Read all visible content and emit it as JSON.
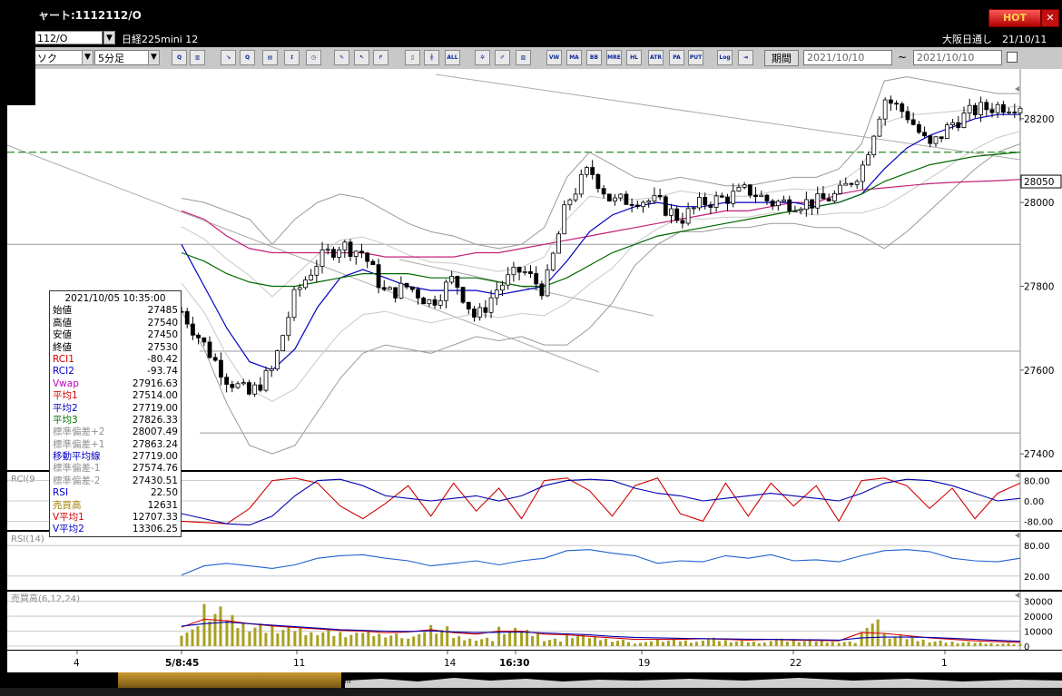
{
  "window": {
    "title": "ャート:1112112/O",
    "hot_label": "HOT",
    "close_label": "✕"
  },
  "toolbar1": {
    "symbol_code": "112/O",
    "symbol_name": "日経225mini 12",
    "exchange_date": "大阪日通し　21/10/11"
  },
  "toolbar2": {
    "chart_type": "ソク",
    "interval": "5分足",
    "period_label": "期間",
    "date_from": "2021/10/10",
    "date_to": "2021/10/10",
    "tilde": "~",
    "buttons": [
      {
        "icon": "zoom-icon",
        "label": "Q"
      },
      {
        "icon": "grid-icon",
        "label": "▥"
      },
      {
        "icon": "trend-icon",
        "label": "↘"
      },
      {
        "icon": "search-icon",
        "label": "Q"
      },
      {
        "icon": "chart-icon",
        "label": "▤"
      },
      {
        "icon": "ticker-icon",
        "label": "↕"
      },
      {
        "icon": "clock-icon",
        "label": "◷"
      },
      {
        "icon": "pen-icon",
        "label": "✎"
      },
      {
        "icon": "pointer-icon",
        "label": "↖"
      },
      {
        "icon": "arrow-icon",
        "label": "↱"
      },
      {
        "icon": "candle-icon",
        "label": "▯"
      },
      {
        "icon": "bar-icon",
        "label": "╫"
      },
      {
        "icon": "all-icon",
        "label": "ALL"
      },
      {
        "icon": "settings-icon",
        "label": "✲"
      },
      {
        "icon": "tool-icon",
        "label": "✐"
      },
      {
        "icon": "color-icon",
        "label": "▨"
      },
      {
        "icon": "vwap-icon",
        "label": "VW"
      },
      {
        "icon": "ma-icon",
        "label": "MA"
      },
      {
        "icon": "bb-icon",
        "label": "BB"
      },
      {
        "icon": "mre-icon",
        "label": "MRE"
      },
      {
        "icon": "hl-icon",
        "label": "HL"
      },
      {
        "icon": "atr-icon",
        "label": "ATR"
      },
      {
        "icon": "para-icon",
        "label": "PA"
      },
      {
        "icon": "put-icon",
        "label": "PUT"
      },
      {
        "icon": "log-icon",
        "label": "Log"
      },
      {
        "icon": "export-icon",
        "label": "⇥"
      }
    ]
  },
  "info": {
    "datetime": "2021/10/05  10:35:00",
    "rows": [
      {
        "k": "始値",
        "v": "27485",
        "c": "#000000"
      },
      {
        "k": "高値",
        "v": "27540",
        "c": "#000000"
      },
      {
        "k": "安値",
        "v": "27450",
        "c": "#000000"
      },
      {
        "k": "終値",
        "v": "27530",
        "c": "#000000"
      },
      {
        "k": "RCI1",
        "v": "-80.42",
        "c": "#d40000"
      },
      {
        "k": "RCI2",
        "v": "-93.74",
        "c": "#0000c8"
      },
      {
        "k": "Vwap",
        "v": "27916.63",
        "c": "#c000c0"
      },
      {
        "k": "平均1",
        "v": "27514.00",
        "c": "#d40000"
      },
      {
        "k": "平均2",
        "v": "27719.00",
        "c": "#0000c8"
      },
      {
        "k": "平均3",
        "v": "27826.33",
        "c": "#007000"
      },
      {
        "k": "標準偏差+2",
        "v": "28007.49",
        "c": "#909090"
      },
      {
        "k": "標準偏差+1",
        "v": "27863.24",
        "c": "#909090"
      },
      {
        "k": "移動平均線",
        "v": "27719.00",
        "c": "#0000c8"
      },
      {
        "k": "標準偏差-1",
        "v": "27574.76",
        "c": "#909090"
      },
      {
        "k": "標準偏差-2",
        "v": "27430.51",
        "c": "#909090"
      },
      {
        "k": "RSI",
        "v": "22.50",
        "c": "#0000c8"
      },
      {
        "k": "売買高",
        "v": "12631",
        "c": "#a08000"
      },
      {
        "k": "V平均1",
        "v": "12707.33",
        "c": "#d40000"
      },
      {
        "k": "V平均2",
        "v": "13306.25",
        "c": "#0000c8"
      }
    ]
  },
  "chart_data": [
    {
      "type": "line",
      "subtype": "candlestick",
      "y_ticks": [
        "28200",
        "28000",
        "27800",
        "27600",
        "27400"
      ],
      "ylim": [
        27370,
        28310
      ],
      "current_price": "28050",
      "x_ticks": [
        "4",
        "5/8:45",
        "11",
        "14",
        "16:30",
        "19",
        "22",
        "1"
      ],
      "price_path": [
        27740,
        27660,
        27580,
        27540,
        27600,
        27780,
        27860,
        27900,
        27880,
        27780,
        27800,
        27760,
        27820,
        27720,
        27800,
        27840,
        27790,
        28000,
        28080,
        28000,
        28010,
        28000,
        27960,
        28000,
        28010,
        28030,
        28000,
        28000,
        28000,
        28020,
        28080,
        28250,
        28210,
        28130,
        28190,
        28220,
        28230,
        28235
      ],
      "reference_lines": [
        28120,
        27900,
        27645,
        27450
      ],
      "series": [
        {
          "name": "Vwap",
          "color": "#c0207a",
          "values": [
            27980,
            27960,
            27920,
            27890,
            27880,
            27880,
            27880,
            27880,
            27880,
            27870,
            27870,
            27870,
            27870,
            27880,
            27880,
            27890,
            27900,
            27910,
            27920,
            27930,
            27940,
            27950,
            27960,
            27970,
            27980,
            27980,
            27990,
            28000,
            28000,
            28020,
            28030,
            28035,
            28040,
            28045,
            28048,
            28050,
            28052,
            28055
          ]
        },
        {
          "name": "平均2",
          "color": "#0000c0",
          "values": [
            27900,
            27800,
            27700,
            27620,
            27600,
            27650,
            27750,
            27820,
            27840,
            27820,
            27800,
            27790,
            27790,
            27790,
            27780,
            27790,
            27800,
            27860,
            27930,
            27970,
            27990,
            28000,
            27990,
            27990,
            28000,
            28000,
            28000,
            28000,
            27990,
            28000,
            28020,
            28080,
            28130,
            28160,
            28180,
            28200,
            28210,
            28210
          ]
        },
        {
          "name": "平均3",
          "color": "#006800",
          "values": [
            27880,
            27860,
            27830,
            27810,
            27800,
            27800,
            27810,
            27820,
            27830,
            27830,
            27830,
            27820,
            27820,
            27820,
            27810,
            27800,
            27800,
            27820,
            27850,
            27880,
            27900,
            27920,
            27930,
            27940,
            27950,
            27960,
            27970,
            27980,
            27990,
            28000,
            28020,
            28050,
            28070,
            28090,
            28100,
            28110,
            28115,
            28120
          ]
        }
      ],
      "bands": [
        {
          "name": "標準偏差+2",
          "values": [
            28010,
            28000,
            27980,
            27960,
            27900,
            27960,
            28000,
            28020,
            28010,
            27980,
            27950,
            27930,
            27920,
            27900,
            27890,
            27900,
            27940,
            28060,
            28120,
            28090,
            28060,
            28050,
            28060,
            28050,
            28040,
            28040,
            28050,
            28060,
            28060,
            28080,
            28140,
            28290,
            28300,
            28290,
            28280,
            28270,
            28260,
            28260
          ]
        },
        {
          "name": "標準偏差-2",
          "values": [
            27740,
            27650,
            27520,
            27420,
            27400,
            27420,
            27500,
            27580,
            27640,
            27660,
            27650,
            27640,
            27660,
            27680,
            27670,
            27680,
            27660,
            27660,
            27700,
            27760,
            27850,
            27900,
            27930,
            27930,
            27940,
            27940,
            27950,
            27950,
            27940,
            27940,
            27920,
            27890,
            27930,
            27980,
            28030,
            28080,
            28120,
            28140
          ]
        }
      ]
    },
    {
      "type": "line",
      "title": "RCI(9",
      "y_ticks": [
        "80.00",
        "0.00",
        "-80.00"
      ],
      "ylim": [
        -100,
        100
      ],
      "series": [
        {
          "name": "RCI1",
          "color": "#d00000",
          "values": [
            -80,
            -85,
            -90,
            -30,
            80,
            90,
            70,
            -20,
            -70,
            -10,
            60,
            -60,
            70,
            -40,
            50,
            -70,
            80,
            90,
            40,
            -60,
            60,
            90,
            -50,
            -80,
            70,
            -60,
            70,
            -20,
            60,
            -80,
            80,
            90,
            60,
            -30,
            50,
            -70,
            30,
            70
          ]
        },
        {
          "name": "RCI2",
          "color": "#0000b0",
          "values": [
            -50,
            -70,
            -90,
            -95,
            -60,
            20,
            80,
            85,
            60,
            20,
            10,
            0,
            10,
            20,
            0,
            20,
            60,
            80,
            85,
            80,
            50,
            30,
            20,
            0,
            10,
            20,
            30,
            20,
            10,
            0,
            30,
            70,
            85,
            80,
            60,
            30,
            0,
            10
          ]
        }
      ]
    },
    {
      "type": "line",
      "title": "RSI(14)",
      "y_ticks": [
        "80.00",
        "20.00"
      ],
      "ylim": [
        0,
        100
      ],
      "series": [
        {
          "name": "RSI",
          "color": "#2060d0",
          "values": [
            22,
            40,
            45,
            40,
            35,
            42,
            55,
            60,
            62,
            55,
            50,
            40,
            45,
            50,
            42,
            50,
            55,
            70,
            72,
            65,
            60,
            45,
            50,
            48,
            60,
            55,
            62,
            50,
            52,
            48,
            60,
            70,
            72,
            68,
            55,
            50,
            48,
            55
          ]
        }
      ]
    },
    {
      "type": "bar",
      "title": "売買高(6,12,24)",
      "y_ticks": [
        "30000",
        "20000",
        "10000",
        "0"
      ],
      "ylim": [
        0,
        34000
      ],
      "volumes": [
        12631,
        30000,
        22000,
        16000,
        14000,
        12000,
        11000,
        9000,
        10000,
        8000,
        9000,
        15000,
        7000,
        6000,
        13000,
        11000,
        5000,
        8000,
        6000,
        4000,
        3000,
        5000,
        4000,
        6000,
        4000,
        3000,
        5000,
        4000,
        3500,
        3000,
        17000,
        9000,
        6000,
        4000,
        3000,
        2500,
        2000,
        1500
      ],
      "series": [
        {
          "name": "V平均1",
          "color": "#d00000",
          "values": [
            12707,
            18000,
            17000,
            15000,
            13500,
            12500,
            11500,
            10500,
            10000,
            9000,
            9500,
            11000,
            9000,
            8000,
            10000,
            10000,
            8000,
            7500,
            6500,
            5500,
            4500,
            4500,
            4500,
            5000,
            4500,
            4000,
            4500,
            4000,
            3800,
            3500,
            9000,
            8500,
            7000,
            5500,
            4500,
            3500,
            3000,
            2500
          ]
        },
        {
          "name": "V平均2",
          "color": "#0000b0",
          "values": [
            13306,
            15000,
            16000,
            15000,
            14000,
            13000,
            12000,
            11000,
            10500,
            10000,
            9800,
            10200,
            9500,
            9000,
            9200,
            9400,
            8800,
            8200,
            7500,
            6500,
            5800,
            5500,
            5200,
            5000,
            4800,
            4600,
            4500,
            4400,
            4200,
            4000,
            5500,
            6000,
            6000,
            5800,
            5200,
            4500,
            3800,
            3200
          ]
        }
      ]
    }
  ]
}
